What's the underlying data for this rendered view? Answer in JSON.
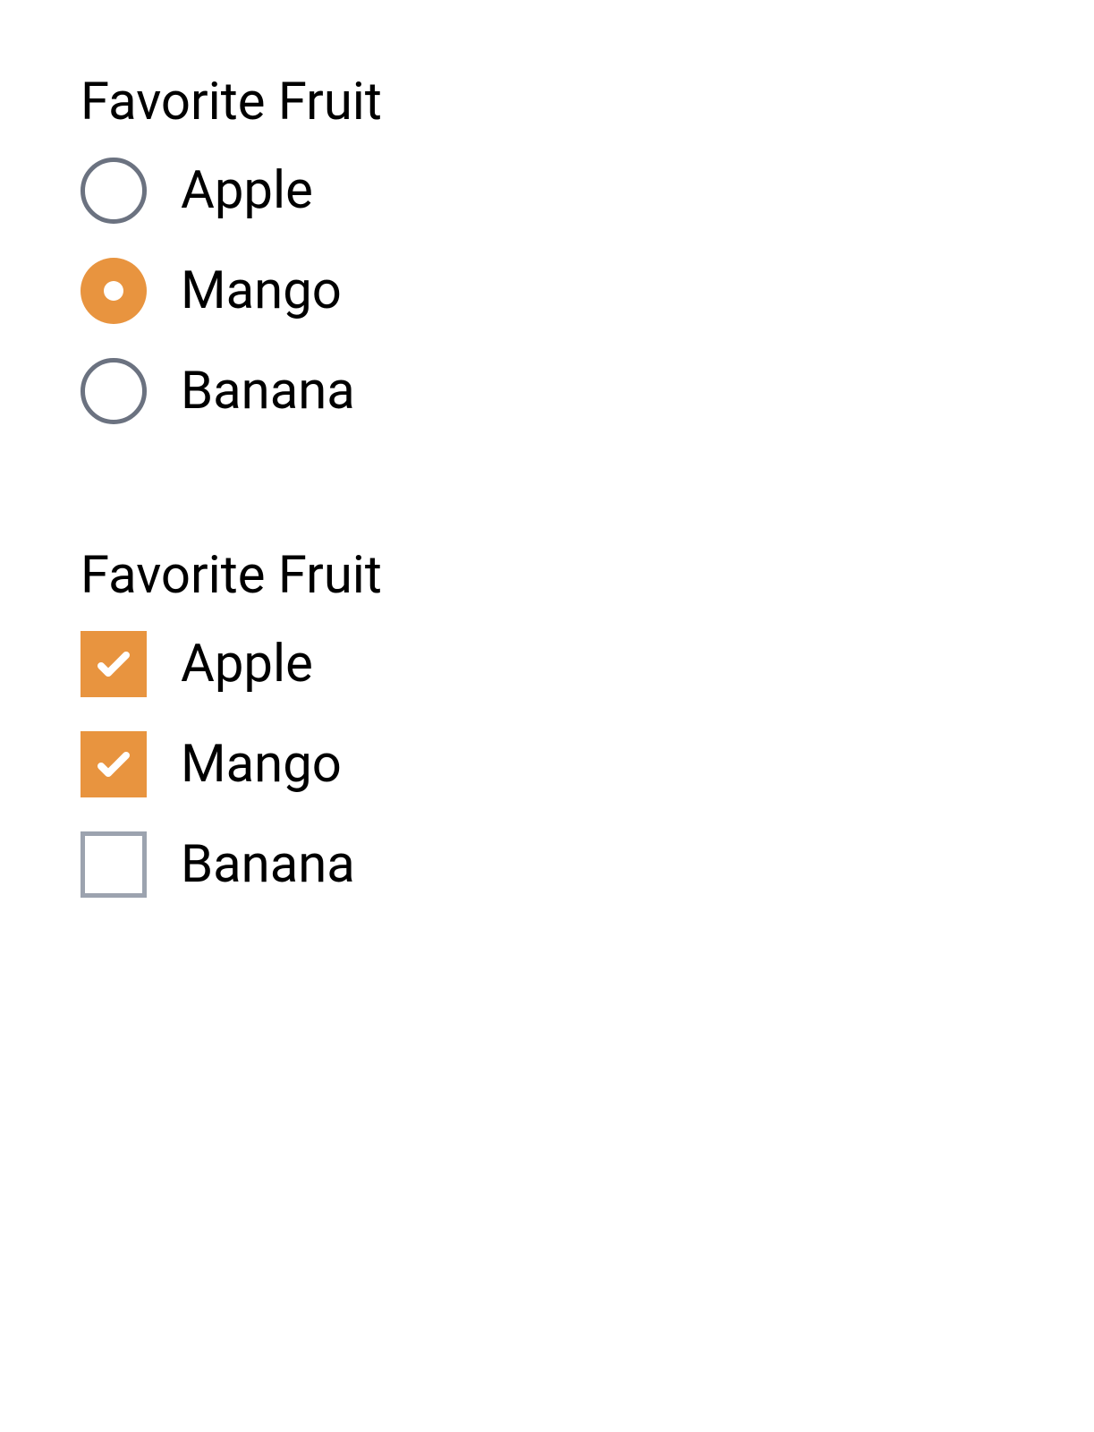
{
  "colors": {
    "accent": "#e8943f",
    "border": "#6b7280",
    "text": "#000000"
  },
  "radioGroup": {
    "title": "Favorite Fruit",
    "options": [
      {
        "label": "Apple",
        "selected": false
      },
      {
        "label": "Mango",
        "selected": true
      },
      {
        "label": "Banana",
        "selected": false
      }
    ]
  },
  "checkboxGroup": {
    "title": "Favorite Fruit",
    "options": [
      {
        "label": "Apple",
        "checked": true
      },
      {
        "label": "Mango",
        "checked": true
      },
      {
        "label": "Banana",
        "checked": false
      }
    ]
  }
}
